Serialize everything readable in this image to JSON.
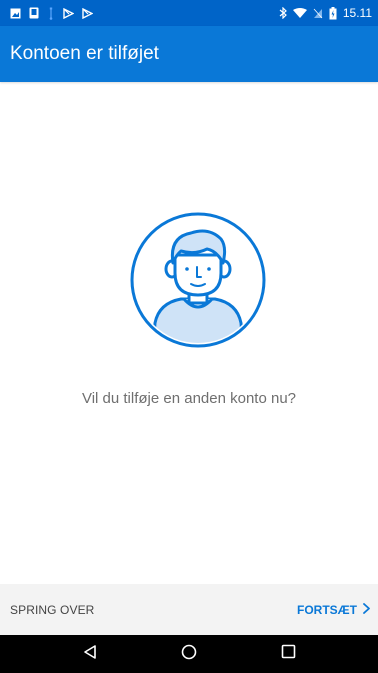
{
  "status_bar": {
    "time": "15.11",
    "left_icons": [
      "image-icon",
      "phone-icon",
      "usb-icon",
      "play-store-icon",
      "play-store-icon"
    ],
    "right_icons": [
      "bluetooth-icon",
      "wifi-icon",
      "sim-icon",
      "battery-icon"
    ]
  },
  "app_bar": {
    "title": "Kontoen er tilføjet"
  },
  "main": {
    "avatar_icon": "user-avatar-icon",
    "prompt": "Vil du tilføje en anden konto nu?"
  },
  "actions": {
    "skip_label": "SPRING OVER",
    "continue_label": "FORTSÆT",
    "continue_icon": "chevron-right-icon"
  },
  "nav_bar": {
    "icons": [
      "back-icon",
      "home-icon",
      "recents-icon"
    ]
  },
  "colors": {
    "status_bar": "#0064c8",
    "app_bar": "#0a78d7",
    "accent": "#0a78d7",
    "avatar_fill": "#cfe3f7",
    "action_bar": "#f3f3f3",
    "nav_bar": "#000000"
  }
}
